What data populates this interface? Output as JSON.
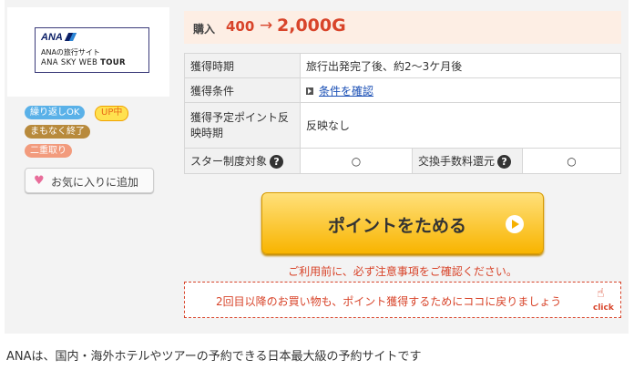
{
  "logo": {
    "brand": "ANA",
    "line1": "ANAの旅行サイト",
    "line2_prefix": "ANA SKY WEB ",
    "line2_bold": "TOUR"
  },
  "badges": {
    "repeat": "繰り返しOK",
    "up": "UP中",
    "ending_soon": "まもなく終了",
    "double": "二重取り"
  },
  "favorite_button": "お気に入りに追加",
  "purchase": {
    "label": "購入",
    "old_points": "400",
    "arrow": "→",
    "new_points": "2,000G"
  },
  "info_table": {
    "timing_label": "獲得時期",
    "timing_value": "旅行出発完了後、約2〜3ケ月後",
    "condition_label": "獲得条件",
    "condition_link": "条件を確認",
    "reflect_label": "獲得予定ポイント反映時期",
    "reflect_value": "反映なし",
    "star_label": "スター制度対象",
    "star_value": "○",
    "exchange_label": "交換手数料還元",
    "exchange_value": "○"
  },
  "cta_button": "ポイントをためる",
  "notice": "ご利用前に、必ず注意事項をご確認ください。",
  "return_box": {
    "text": "2回目以降のお買い物も、ポイント獲得するためにココに戻りましょう",
    "click": "click"
  },
  "description": "ANAは、国内・海外ホテルやツアーの予約できる日本最大級の予約サイトです"
}
